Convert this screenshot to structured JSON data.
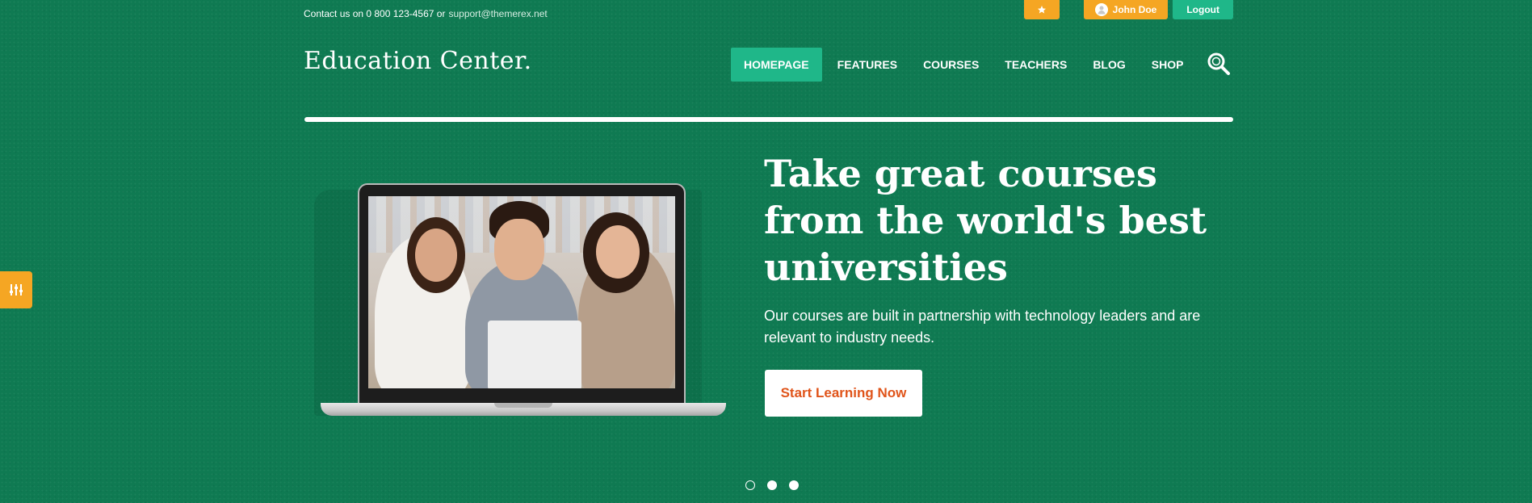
{
  "topbar": {
    "contact_label": "Contact us on 0 800 123-4567 or",
    "email": "support@themerex.net",
    "user_name": "John Doe",
    "logout_label": "Logout"
  },
  "header": {
    "logo": "Education Center.",
    "nav": [
      {
        "label": "HOMEPAGE",
        "active": true
      },
      {
        "label": "FEATURES",
        "active": false
      },
      {
        "label": "COURSES",
        "active": false
      },
      {
        "label": "TEACHERS",
        "active": false
      },
      {
        "label": "BLOG",
        "active": false
      },
      {
        "label": "SHOP",
        "active": false
      }
    ]
  },
  "hero": {
    "title": "Take great courses from the world's best universities",
    "subtitle": "Our courses are built in partnership with technology leaders and are relevant to industry needs.",
    "cta_label": "Start Learning Now",
    "slider": {
      "slides": 3,
      "active_index": 0
    }
  },
  "colors": {
    "background": "#0f7a52",
    "accent_green": "#1fb789",
    "accent_orange": "#f5a623",
    "cta_text": "#e0541a"
  },
  "icons": {
    "star": "star-icon",
    "user": "user-icon",
    "search": "search-icon",
    "settings": "sliders-icon"
  }
}
